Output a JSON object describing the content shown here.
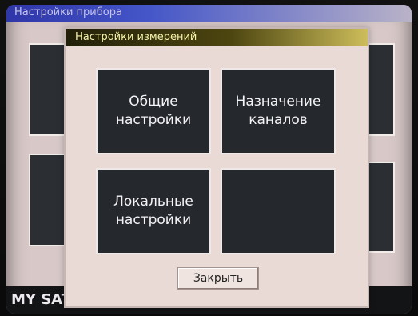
{
  "background_window": {
    "title": "Настройки прибора"
  },
  "dialog": {
    "title": "Настройки измерений",
    "tiles": [
      {
        "label": "Общие\nнастройки"
      },
      {
        "label": "Назначение\nканалов"
      },
      {
        "label": "Локальные\nнастройки"
      },
      {
        "label": ""
      }
    ],
    "close_label": "Закрыть"
  },
  "status_bar": {
    "text": "MY SATEC_"
  },
  "colors": {
    "screen_bg": "#d8c9c8",
    "tile_bg": "#25282d",
    "dialog_bg": "#e9dad6",
    "title_text": "#f6f3a8"
  }
}
